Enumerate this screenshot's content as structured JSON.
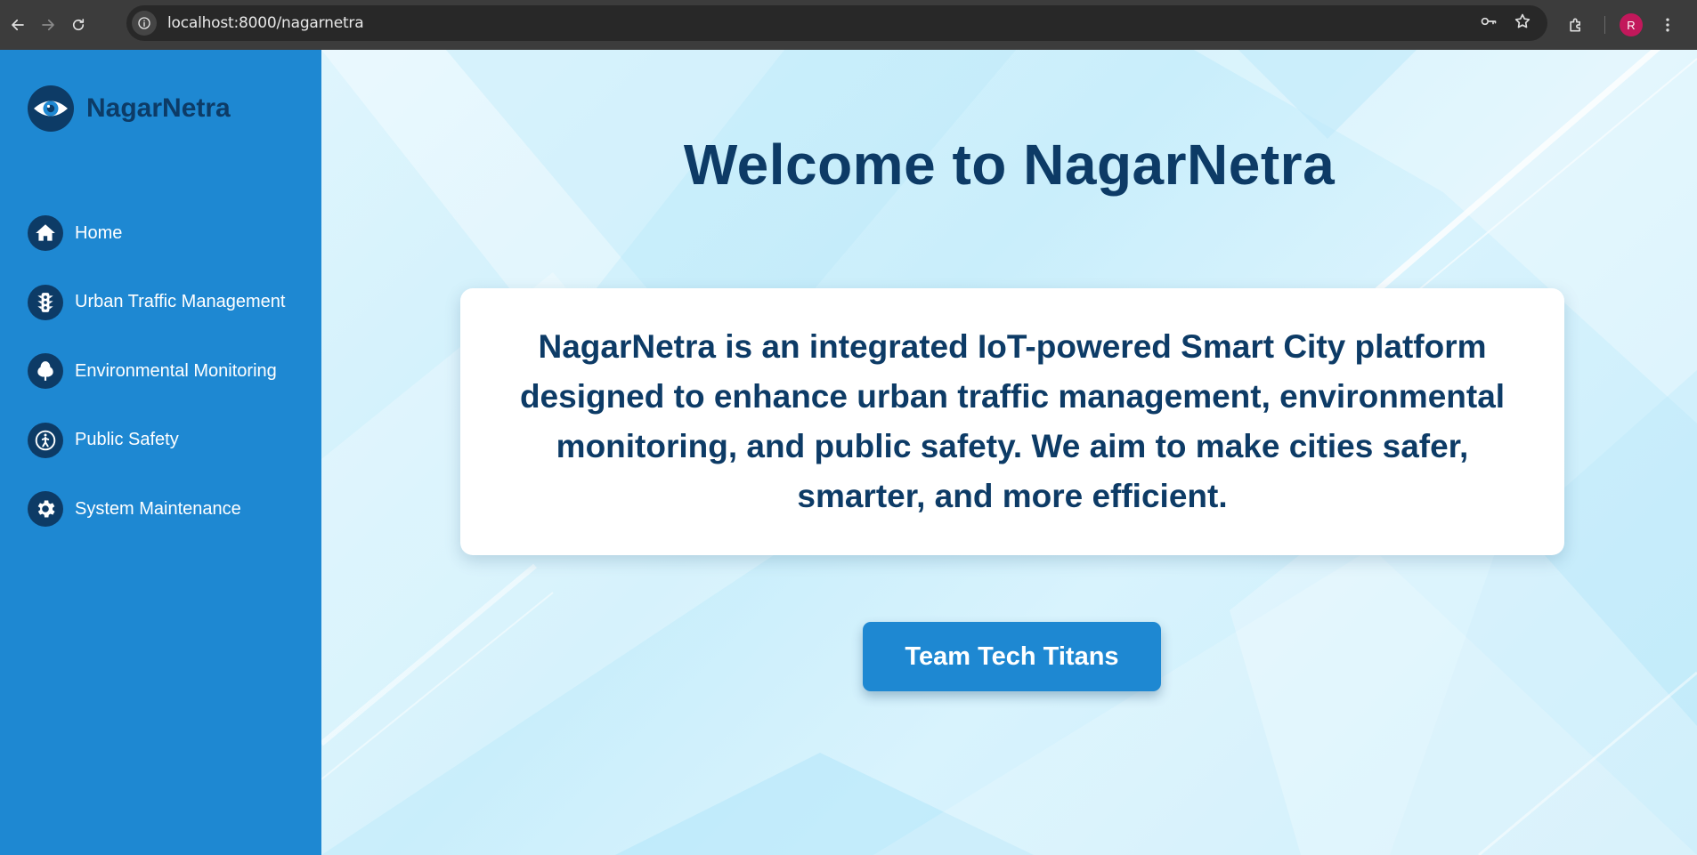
{
  "browser": {
    "url": "localhost:8000/nagarnetra",
    "profile_initial": "R",
    "profile_color": "#c2185b"
  },
  "sidebar": {
    "brand": "NagarNetra",
    "items": [
      {
        "label": "Home",
        "icon": "home-icon"
      },
      {
        "label": "Urban Traffic Management",
        "icon": "traffic-light-icon"
      },
      {
        "label": "Environmental Monitoring",
        "icon": "tree-icon"
      },
      {
        "label": "Public Safety",
        "icon": "pedestrian-icon"
      },
      {
        "label": "System Maintenance",
        "icon": "gear-icon"
      }
    ]
  },
  "main": {
    "title": "Welcome to NagarNetra",
    "description": "NagarNetra is an integrated IoT-powered Smart City platform designed to enhance urban traffic management, environmental monitoring, and public safety. We aim to make cities safer, smarter, and more efficient.",
    "button_label": "Team Tech Titans"
  },
  "colors": {
    "sidebar": "#1e88d2",
    "navy": "#0d3b66",
    "button": "#1e88d2",
    "card": "#ffffff"
  }
}
